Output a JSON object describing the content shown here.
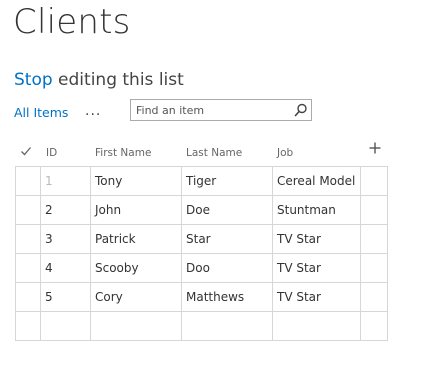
{
  "page": {
    "title": "Clients"
  },
  "edit_mode": {
    "stop_label": "Stop",
    "rest_label": " editing this list"
  },
  "views": {
    "current": "All Items",
    "more_label": "..."
  },
  "search": {
    "placeholder": "Find an item",
    "value": "",
    "icon": "search-icon"
  },
  "grid": {
    "columns": [
      "ID",
      "First Name",
      "Last Name",
      "Job"
    ],
    "select_icon": "checkmark-icon",
    "add_column_icon": "plus-icon",
    "rows": [
      {
        "id": "1",
        "first_name": "Tony",
        "last_name": "Tiger",
        "job": "Cereal Model"
      },
      {
        "id": "2",
        "first_name": "John",
        "last_name": "Doe",
        "job": "Stuntman"
      },
      {
        "id": "3",
        "first_name": "Patrick",
        "last_name": "Star",
        "job": "TV Star"
      },
      {
        "id": "4",
        "first_name": "Scooby",
        "last_name": "Doo",
        "job": "TV Star"
      },
      {
        "id": "5",
        "first_name": "Cory",
        "last_name": "Matthews",
        "job": "TV Star"
      }
    ]
  },
  "colors": {
    "accent": "#0072c6",
    "grid_line": "#d6d6d6",
    "text": "#333333"
  }
}
